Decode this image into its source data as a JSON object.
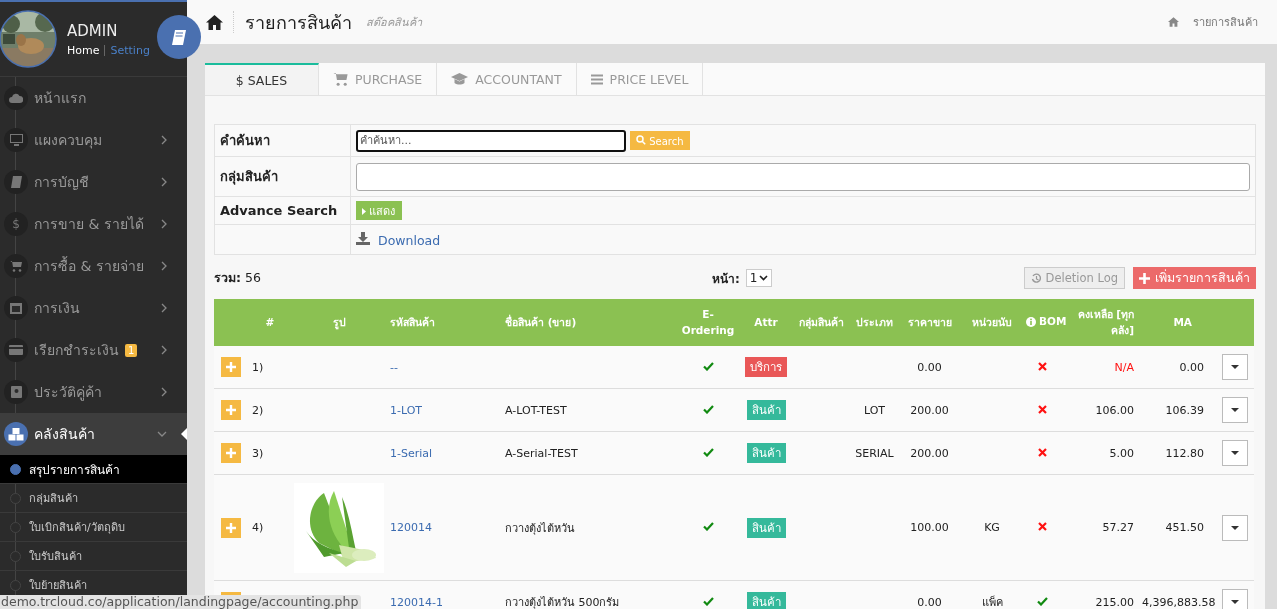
{
  "sidebar": {
    "user": {
      "name": "ADMIN",
      "links": [
        {
          "label": "Home",
          "selected": true
        },
        {
          "label": "Setting",
          "selected": false
        }
      ]
    },
    "items": [
      {
        "label": "หน้าแรก",
        "selected": false
      },
      {
        "label": "แผงควบคุม",
        "selected": false,
        "expanded": false
      },
      {
        "label": "การบัญชี",
        "selected": false,
        "expanded": false
      },
      {
        "label": "การขาย & รายได้",
        "glyph": "$",
        "selected": false,
        "expanded": false
      },
      {
        "label": "การซื้อ & รายจ่าย",
        "selected": false,
        "expanded": false
      },
      {
        "label": "การเงิน",
        "selected": false,
        "expanded": false
      },
      {
        "label": "เรียกชำระเงิน",
        "badge": "1",
        "selected": false,
        "expanded": false
      },
      {
        "label": "ประวัติคู่ค้า",
        "selected": false,
        "expanded": false
      },
      {
        "label": "คลังสินค้า",
        "selected": true,
        "expanded": true,
        "children": [
          {
            "label": "สรุปรายการสินค้า",
            "selected": true
          },
          {
            "label": "กลุ่มสินค้า",
            "selected": false
          },
          {
            "label": "ใบเบิกสินค้า/วัตถุดิบ",
            "selected": false
          },
          {
            "label": "ใบรับสินค้า",
            "selected": false
          },
          {
            "label": "ใบย้ายสินค้า",
            "selected": false
          }
        ]
      }
    ]
  },
  "header": {
    "title": "รายการสินค้า",
    "subtitle": "สต๊อคสินค้า",
    "breadcrumb": "รายการสินค้า"
  },
  "tabs": [
    {
      "label": "$ SALES",
      "selected": true
    },
    {
      "label": "PURCHASE",
      "selected": false
    },
    {
      "label": "ACCOUNTANT",
      "selected": false
    },
    {
      "label": "PRICE LEVEL",
      "selected": false
    }
  ],
  "search_form": {
    "keyword_label": "คำค้นหา",
    "keyword_placeholder": "คำค้นหา...",
    "search_button": "Search",
    "group_label": "กลุ่มสินค้า",
    "advance_label": "Advance Search",
    "show_button": "แสดง",
    "download_link": "Download"
  },
  "summary": {
    "total": "**รวม:** 56",
    "page_label": "หน้า:",
    "page": "1",
    "deletion_log_button": "Deletion Log",
    "add_button": "เพิ่มรายการสินค้า"
  },
  "table": {
    "columns": [
      "#",
      "รูป",
      "รหัสสินค้า",
      "ชื่อสินค้า (ขาย)",
      "E-Ordering",
      "Attr",
      "กลุ่มสินค้า",
      "ประเภท",
      "ราคาขาย",
      "หน่วยนับ",
      "BOM",
      "คงเหลือ [ทุกคลัง]",
      "MA"
    ],
    "rows": [
      {
        "no": "1)",
        "has_picture": false,
        "code": "--",
        "name": "",
        "e_ordering": true,
        "attr": {
          "label": "บริการ",
          "color": "#e95757"
        },
        "type": "",
        "price": "0.00",
        "unit": "",
        "bom": false,
        "stock": "N/A",
        "stock_known": false,
        "ma": "0.00"
      },
      {
        "no": "2)",
        "has_picture": false,
        "code": "1-LOT",
        "name": "A-LOT-TEST",
        "e_ordering": true,
        "attr": {
          "label": "สินค้า",
          "color": "#35b99b"
        },
        "type": "LOT",
        "price": "200.00",
        "unit": "",
        "bom": false,
        "stock": "106.00",
        "stock_known": true,
        "ma": "106.39"
      },
      {
        "no": "3)",
        "has_picture": false,
        "code": "1-Serial",
        "name": "A-Serial-TEST",
        "e_ordering": true,
        "attr": {
          "label": "สินค้า",
          "color": "#35b99b"
        },
        "type": "SERIAL",
        "price": "200.00",
        "unit": "",
        "bom": false,
        "stock": "5.00",
        "stock_known": true,
        "ma": "112.80"
      },
      {
        "no": "4)",
        "has_picture": true,
        "code": "120014",
        "name": "กวางตุ้งไต้หวัน",
        "e_ordering": true,
        "attr": {
          "label": "สินค้า",
          "color": "#35b99b"
        },
        "type": "",
        "price": "100.00",
        "unit": "KG",
        "bom": false,
        "stock": "57.27",
        "stock_known": true,
        "ma": "451.50"
      },
      {
        "has_picture": false,
        "code": "120014-1",
        "name": "กวางตุ้งไต้หวัน 500กรัม",
        "e_ordering": true,
        "attr": {
          "label": "สินค้า",
          "color": "#35b99b"
        },
        "type": "",
        "price": "0.00",
        "unit": "แพ็ค",
        "bom": true,
        "stock": "215.00",
        "stock_known": true,
        "ma": "4,396,883.58"
      }
    ]
  },
  "status_url": "demo.trcloud.co/application/landingpage/accounting.php"
}
